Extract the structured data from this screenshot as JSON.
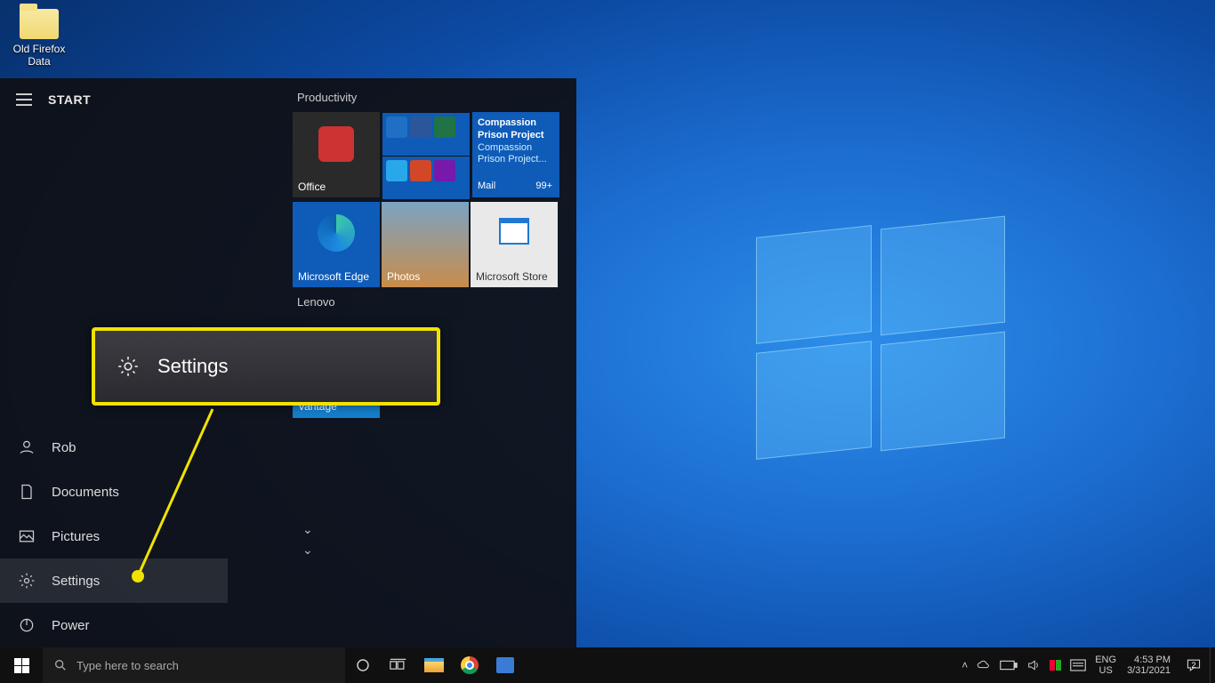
{
  "desktop": {
    "icon_label": "Old Firefox Data"
  },
  "start_menu": {
    "title": "START",
    "groups": {
      "productivity": {
        "label": "Productivity"
      },
      "lenovo": {
        "label": "Lenovo"
      }
    },
    "tiles": {
      "office": "Office",
      "mail": {
        "headline1": "Compassion Prison Project",
        "headline2": "Compassion Prison Project...",
        "label": "Mail",
        "badge": "99+"
      },
      "edge": "Microsoft Edge",
      "photos": "Photos",
      "store": "Microsoft Store",
      "vantage": "Vantage"
    },
    "rail": {
      "user": "Rob",
      "documents": "Documents",
      "pictures": "Pictures",
      "settings": "Settings",
      "power": "Power"
    }
  },
  "tooltip": {
    "label": "Settings"
  },
  "taskbar": {
    "search_placeholder": "Type here to search",
    "language_code": "ENG",
    "language_region": "US",
    "time": "4:53 PM",
    "date": "3/31/2021",
    "action_center_count": "2"
  }
}
